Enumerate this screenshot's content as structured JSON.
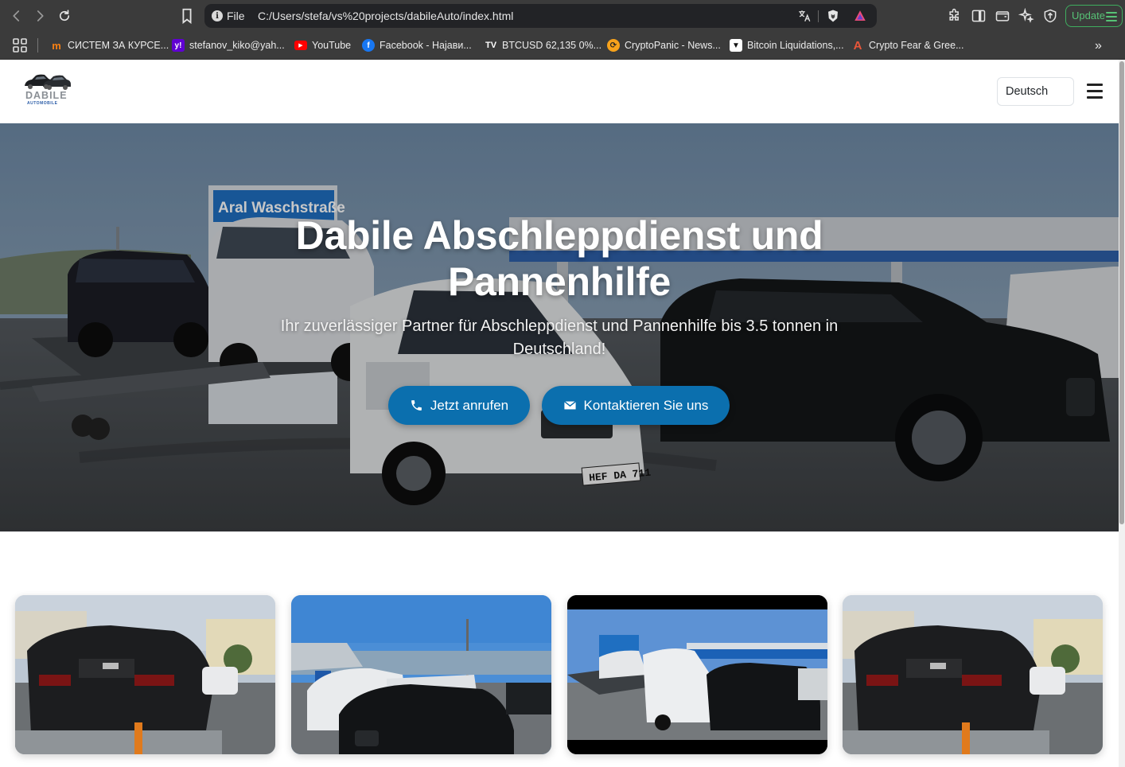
{
  "browser": {
    "url_scheme": "File",
    "url": "C:/Users/stefa/vs%20projects/dabileAuto/index.html",
    "update_label": "Update",
    "bookmarks": [
      {
        "label": "СИСТЕМ ЗА КУРСЕ...",
        "icon": "moodle-icon"
      },
      {
        "label": "stefanov_kiko@yah...",
        "icon": "yahoo-mail-icon"
      },
      {
        "label": "YouTube",
        "icon": "youtube-icon"
      },
      {
        "label": "Facebook - Најави...",
        "icon": "facebook-icon"
      },
      {
        "label": "BTCUSD 62,135 0%...",
        "icon": "tradingview-icon"
      },
      {
        "label": "CryptoPanic - News...",
        "icon": "cryptopanic-icon"
      },
      {
        "label": "Bitcoin Liquidations,...",
        "icon": "coinglass-icon"
      },
      {
        "label": "Crypto Fear & Gree...",
        "icon": "alternative-me-icon"
      }
    ]
  },
  "site": {
    "logo_text": "DABILE",
    "logo_subtext": "AUTOMOBILE",
    "language": "Deutsch",
    "hero": {
      "title": "Dabile Abschleppdienst und Pannenhilfe",
      "subtitle": "Ihr zuverlässiger Partner für Abschleppdienst und Pannenhilfe bis 3.5 tonnen in Deutschland!",
      "call_button": "Jetzt anrufen",
      "contact_button": "Kontaktieren Sie uns",
      "sign_text": "Aral Waschstraße",
      "plate_text": "HEF DA 711"
    },
    "gallery": [
      {
        "name": "gallery-image-audi-on-trailer"
      },
      {
        "name": "gallery-image-gas-station-cars"
      },
      {
        "name": "gallery-image-tow-truck-station"
      },
      {
        "name": "gallery-image-audi-on-trailer-2"
      }
    ]
  }
}
